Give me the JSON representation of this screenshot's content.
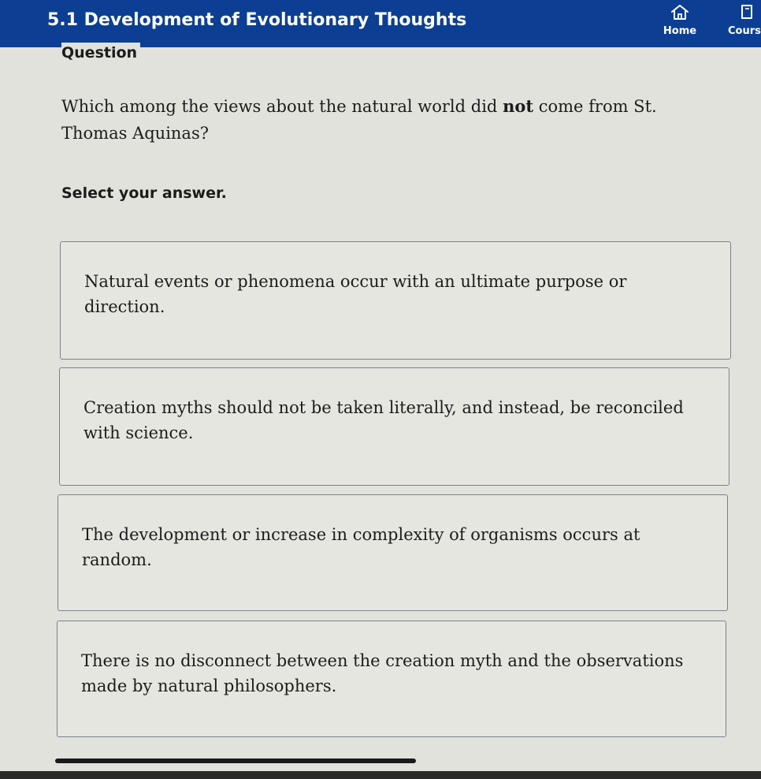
{
  "header": {
    "title": "5.1 Development of Evolutionary Thoughts",
    "home_label": "Home",
    "home_icon": "home-icon",
    "courses_label": "Cours",
    "courses_icon": "courses-icon",
    "background_color": "#0c3f93"
  },
  "question": {
    "section_label": "Question",
    "prompt_before": "Which among the views about the natural world did ",
    "prompt_emphasis": "not",
    "prompt_after": " come from St. Thomas Aquinas?",
    "instruction": "Select your answer."
  },
  "options": [
    {
      "text": "Natural events or phenomena occur with an ultimate purpose or direction."
    },
    {
      "text": "Creation myths should not be taken literally, and instead, be reconciled with science."
    },
    {
      "text": "The development or increase in complexity of organisms occurs at random."
    },
    {
      "text": "There is no disconnect between the creation myth and the observations made by natural philosophers."
    }
  ]
}
